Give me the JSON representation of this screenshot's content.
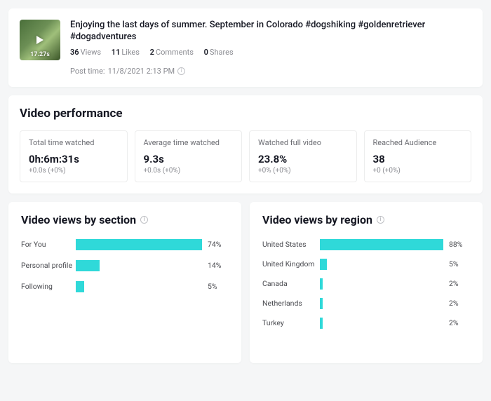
{
  "header": {
    "duration": "17.27s",
    "title": "Enjoying the last days of summer. September in Colorado #dogshiking #goldenretriever #dogadventures",
    "stats": {
      "views_value": "36",
      "views_label": "Views",
      "likes_value": "11",
      "likes_label": "Likes",
      "comments_value": "2",
      "comments_label": "Comments",
      "shares_value": "0",
      "shares_label": "Shares"
    },
    "post_time_label": "Post time:",
    "post_time_value": "11/8/2021 2:13 PM"
  },
  "performance": {
    "title": "Video performance",
    "boxes": [
      {
        "label": "Total time watched",
        "value": "0h:6m:31s",
        "delta": "+0.0s (+0%)"
      },
      {
        "label": "Average time watched",
        "value": "9.3s",
        "delta": "+0.0s (+0%)"
      },
      {
        "label": "Watched full video",
        "value": "23.8%",
        "delta": "+0% (+0%)"
      },
      {
        "label": "Reached Audience",
        "value": "38",
        "delta": "+0 (+0%)"
      }
    ]
  },
  "section_chart": {
    "title": "Video views by section",
    "rows": [
      {
        "label": "For You",
        "pct": 74,
        "display": "74%"
      },
      {
        "label": "Personal profile",
        "pct": 14,
        "display": "14%"
      },
      {
        "label": "Following",
        "pct": 5,
        "display": "5%"
      }
    ]
  },
  "region_chart": {
    "title": "Video views by region",
    "rows": [
      {
        "label": "United States",
        "pct": 88,
        "display": "88%"
      },
      {
        "label": "United Kingdom",
        "pct": 5,
        "display": "5%"
      },
      {
        "label": "Canada",
        "pct": 2,
        "display": "2%"
      },
      {
        "label": "Netherlands",
        "pct": 2,
        "display": "2%"
      },
      {
        "label": "Turkey",
        "pct": 2,
        "display": "2%"
      }
    ]
  },
  "colors": {
    "bar": "#2fd9d9"
  },
  "chart_data": [
    {
      "type": "bar",
      "orientation": "horizontal",
      "title": "Video views by section",
      "xlabel": "",
      "ylabel": "",
      "xlim": [
        0,
        100
      ],
      "categories": [
        "For You",
        "Personal profile",
        "Following"
      ],
      "values": [
        74,
        14,
        5
      ],
      "unit": "percent"
    },
    {
      "type": "bar",
      "orientation": "horizontal",
      "title": "Video views by region",
      "xlabel": "",
      "ylabel": "",
      "xlim": [
        0,
        100
      ],
      "categories": [
        "United States",
        "United Kingdom",
        "Canada",
        "Netherlands",
        "Turkey"
      ],
      "values": [
        88,
        5,
        2,
        2,
        2
      ],
      "unit": "percent"
    }
  ]
}
